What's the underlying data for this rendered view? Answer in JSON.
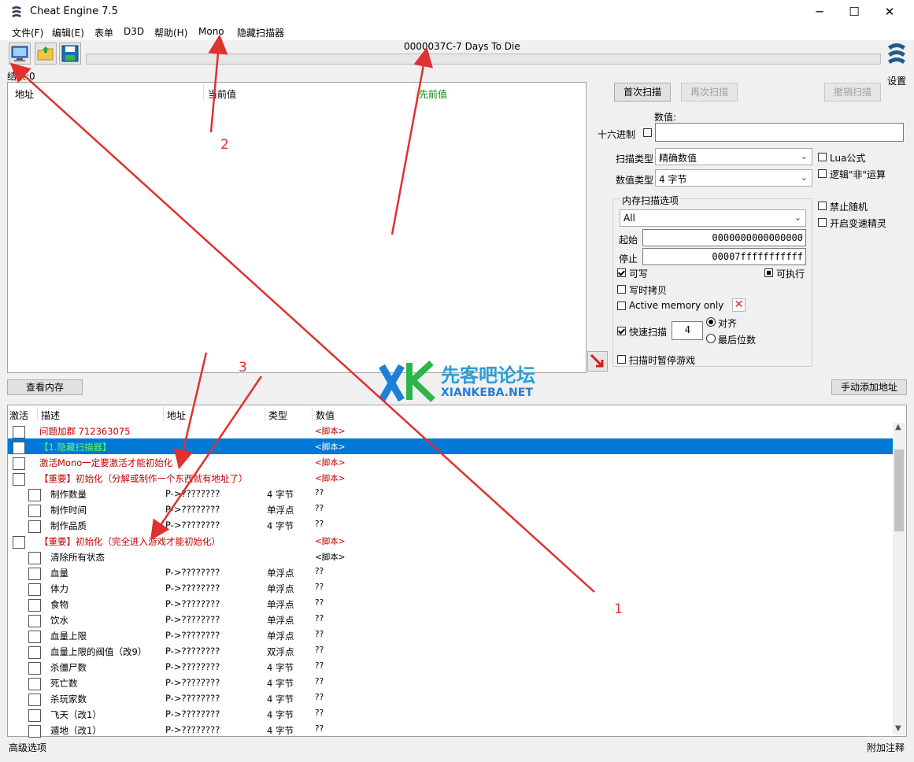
{
  "window": {
    "title": "Cheat Engine 7.5",
    "min": "─",
    "max": "☐",
    "close": "✕"
  },
  "menu": [
    "文件(F)",
    "编辑(E)",
    "表单",
    "D3D",
    "帮助(H)",
    "Mono",
    "隐藏扫描器"
  ],
  "process_name": "0000037C-7 Days To Die",
  "settings_label": "设置",
  "found_label": "结果:0",
  "results_columns": {
    "address": "地址",
    "current": "当前值",
    "previous": "先前值"
  },
  "scan": {
    "first_scan": "首次扫描",
    "next_scan": "再次扫描",
    "undo_scan": "撤销扫描",
    "value_label": "数值:",
    "hex_label": "十六进制",
    "value_input": "",
    "scan_type_label": "扫描类型",
    "scan_type_value": "精确数值",
    "value_type_label": "数值类型",
    "value_type_value": "4 字节",
    "lua_label": "Lua公式",
    "not_label": "逻辑\"非\"运算",
    "mem_options_label": "内存扫描选项",
    "region_value": "All",
    "start_label": "起始",
    "start_value": "0000000000000000",
    "stop_label": "停止",
    "stop_value": "00007fffffffffff",
    "writable_label": "可写",
    "executable_label": "可执行",
    "copy_on_write_label": "写时拷贝",
    "active_memory_label": "Active memory only",
    "fast_scan_label": "快速扫描",
    "fast_scan_value": "4",
    "align_label": "对齐",
    "last_digits_label": "最后位数",
    "pause_label": "扫描时暂停游戏",
    "no_random_label": "禁止随机",
    "speedhack_label": "开启变速精灵"
  },
  "view_memory_button": "查看内存",
  "add_address_button": "手动添加地址",
  "table_columns": {
    "active": "激活",
    "description": "描述",
    "address": "地址",
    "type": "类型",
    "value": "数值"
  },
  "rows": [
    {
      "indent": 0,
      "desc": "问题加群  712363075",
      "addr": "",
      "type": "",
      "value": "<脚本>",
      "style": "red"
    },
    {
      "indent": 0,
      "desc": "【1.隐藏扫描器】",
      "addr": "",
      "type": "",
      "value": "<脚本>",
      "style": "selected"
    },
    {
      "indent": 0,
      "desc": "激活Mono一定要激活才能初始化",
      "addr": "",
      "type": "",
      "value": "<脚本>",
      "style": "red"
    },
    {
      "indent": 0,
      "desc": "【重要】初始化（分解或制作一个东西就有地址了）",
      "addr": "",
      "type": "",
      "value": "<脚本>",
      "style": "red"
    },
    {
      "indent": 1,
      "desc": "制作数量",
      "addr": "P->????????",
      "type": "4 字节",
      "value": "??",
      "style": ""
    },
    {
      "indent": 1,
      "desc": "制作时间",
      "addr": "P->????????",
      "type": "单浮点",
      "value": "??",
      "style": ""
    },
    {
      "indent": 1,
      "desc": "制作品质",
      "addr": "P->????????",
      "type": "4 字节",
      "value": "??",
      "style": ""
    },
    {
      "indent": 0,
      "desc": "【重要】初始化（完全进入游戏才能初始化）",
      "addr": "",
      "type": "",
      "value": "<脚本>",
      "style": "red"
    },
    {
      "indent": 1,
      "desc": "清除所有状态",
      "addr": "",
      "type": "",
      "value": "<脚本>",
      "style": ""
    },
    {
      "indent": 1,
      "desc": "血量",
      "addr": "P->????????",
      "type": "单浮点",
      "value": "??",
      "style": ""
    },
    {
      "indent": 1,
      "desc": "体力",
      "addr": "P->????????",
      "type": "单浮点",
      "value": "??",
      "style": ""
    },
    {
      "indent": 1,
      "desc": "食物",
      "addr": "P->????????",
      "type": "单浮点",
      "value": "??",
      "style": ""
    },
    {
      "indent": 1,
      "desc": "饮水",
      "addr": "P->????????",
      "type": "单浮点",
      "value": "??",
      "style": ""
    },
    {
      "indent": 1,
      "desc": "血量上限",
      "addr": "P->????????",
      "type": "单浮点",
      "value": "??",
      "style": ""
    },
    {
      "indent": 1,
      "desc": "血量上限的阀值（改9）",
      "addr": "P->????????",
      "type": "双浮点",
      "value": "??",
      "style": ""
    },
    {
      "indent": 1,
      "desc": "杀僵尸数",
      "addr": "P->????????",
      "type": "4 字节",
      "value": "??",
      "style": ""
    },
    {
      "indent": 1,
      "desc": "死亡数",
      "addr": "P->????????",
      "type": "4 字节",
      "value": "??",
      "style": ""
    },
    {
      "indent": 1,
      "desc": "杀玩家数",
      "addr": "P->????????",
      "type": "4 字节",
      "value": "??",
      "style": ""
    },
    {
      "indent": 1,
      "desc": "飞天（改1）",
      "addr": "P->????????",
      "type": "4 字节",
      "value": "??",
      "style": ""
    },
    {
      "indent": 1,
      "desc": "遁地（改1）",
      "addr": "P->????????",
      "type": "4 字节",
      "value": "??",
      "style": ""
    }
  ],
  "status_left": "高级选项",
  "status_right": "附加注释",
  "watermark": {
    "cn": "先客吧论坛",
    "en": "XIANKEBA.NET"
  },
  "annotations": [
    "1",
    "2",
    "3"
  ],
  "colors": {
    "accent": "#0078d7",
    "red_text": "#c00000",
    "annotation": "#e03030"
  }
}
